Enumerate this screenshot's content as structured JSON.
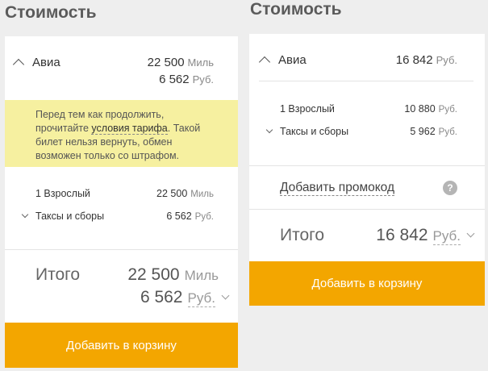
{
  "left": {
    "heading": "Стоимость",
    "air_label": "Авиа",
    "air_miles": "22 500",
    "air_miles_unit": "Миль",
    "air_rub": "6 562",
    "air_rub_unit": "Руб.",
    "notice_part1": "Перед тем как продолжить,",
    "notice_part2": "прочитайте ",
    "notice_link": "условия тарифа",
    "notice_part3": ". Такой",
    "notice_part4": "билет нельзя вернуть, обмен",
    "notice_part5": "возможен только со штрафом.",
    "adult_label": "1 Взрослый",
    "adult_amt": "22 500",
    "adult_unit": "Миль",
    "taxes_label": "Таксы и сборы",
    "taxes_amt": "6 562",
    "taxes_unit": "Руб.",
    "total_label": "Итого",
    "total_miles": "22 500",
    "total_miles_unit": "Миль",
    "total_rub": "6 562",
    "total_rub_unit": "Руб.",
    "cart_button": "Добавить в корзину"
  },
  "right": {
    "heading": "Стоимость",
    "air_label": "Авиа",
    "air_amt": "16 842",
    "air_unit": "Руб.",
    "adult_label": "1 Взрослый",
    "adult_amt": "10 880",
    "adult_unit": "Руб.",
    "taxes_label": "Таксы и сборы",
    "taxes_amt": "5 962",
    "taxes_unit": "Руб.",
    "promo_label": "Добавить промокод",
    "help_glyph": "?",
    "total_label": "Итого",
    "total_amt": "16 842",
    "total_unit": "Руб.",
    "cart_button": "Добавить в корзину"
  }
}
